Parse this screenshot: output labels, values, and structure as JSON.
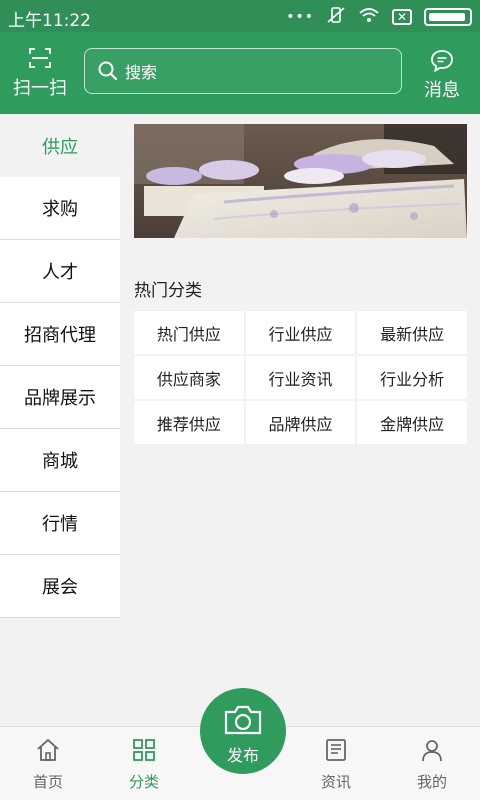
{
  "status": {
    "time": "上午11:22"
  },
  "header": {
    "scan_label": "扫一扫",
    "search_placeholder": "搜索",
    "message_label": "消息"
  },
  "sidebar": {
    "items": [
      {
        "label": "供应",
        "active": true
      },
      {
        "label": "求购"
      },
      {
        "label": "人才"
      },
      {
        "label": "招商代理"
      },
      {
        "label": "品牌展示"
      },
      {
        "label": "商城"
      },
      {
        "label": "行情"
      },
      {
        "label": "展会"
      }
    ]
  },
  "main": {
    "section_title": "热门分类",
    "categories": [
      "热门供应",
      "行业供应",
      "最新供应",
      "供应商家",
      "行业资讯",
      "行业分析",
      "推荐供应",
      "品牌供应",
      "金牌供应"
    ]
  },
  "bottom_nav": {
    "home": "首页",
    "category": "分类",
    "publish": "发布",
    "news": "资讯",
    "mine": "我的"
  },
  "colors": {
    "brand": "#2f9b5d",
    "status_bar": "#2f8f57"
  }
}
